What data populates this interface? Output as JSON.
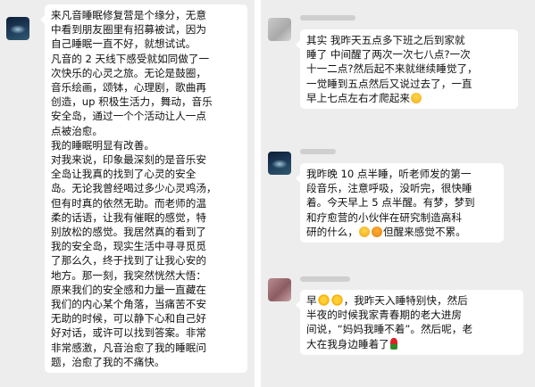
{
  "left": {
    "message": {
      "lines": [
        "来凡音睡眠修复营是个缘分，无意",
        "中看到朋友圈里有招募被试，因为",
        "自己睡眠一直不好，就想试试。",
        "凡音的 2 天线下感受就如同做了一",
        "次快乐的心灵之旅。无论是鼓圈，",
        "音乐绘画，颂钵，心理剧，歌曲再",
        "创造，up 积极生活力，舞动，音乐",
        "安全岛，通过一个个活动让人一点",
        "点被治愈。",
        "我的睡眠明显有改善。",
        "对我来说，印象最深刻的是音乐安",
        "全岛让我真的找到了心灵的安全",
        "岛。无论我曾经喝过多少心灵鸡汤，",
        "但有时真的依然无助。而老师的温",
        "柔的话语，让我有催眠的感觉，特",
        "别放松的感觉。我居然真的看到了",
        "我的安全岛，现实生活中寻寻觅觅",
        "了那么久，终于找到了让我心安的",
        "地方。那一刻，我突然恍然大悟：",
        "原来我们的安全感和力量一直藏在",
        "我们的内心某个角落，当痛苦不安",
        "无助的时候，可以静下心和自己好",
        "好对话，或许可以找到答案。非常",
        "非常感激，凡音治愈了我的睡眠问",
        "题，治愈了我的不痛快。"
      ]
    }
  },
  "right": {
    "messages": [
      {
        "lines": [
          "其实 我昨天五点多下班之后到家就",
          "睡了 中间醒了两次一次七八点?一次",
          "十一二点?然后起不来就继续睡觉了，",
          "一觉睡到五点然后又说过去了，一直",
          "早上七点左右才爬起来"
        ],
        "emoji_end": "laughing-sweat-emoji"
      },
      {
        "lines": [
          "我昨晚 10 点半睡，听老师发的第一",
          "段音乐，注意呼吸，没听完，很快睡",
          "着。今天早上 5 点半醒。有梦，梦到",
          "和疗愈营的小伙伴在研究制造高科",
          "研的什么，",
          "但醒来感觉不累。"
        ],
        "emojis_mid": [
          "smiling-sweat-emoji",
          "shocked-emoji"
        ]
      },
      {
        "line1_prefix": "早",
        "line1_text": "，我昨天入睡特别快，然后",
        "lines": [
          "半夜的时候我家青春期的老大进房",
          "间说，“妈妈我睡不着”。然后呢，老"
        ],
        "last_line": "大在我身边睡着了"
      }
    ]
  }
}
